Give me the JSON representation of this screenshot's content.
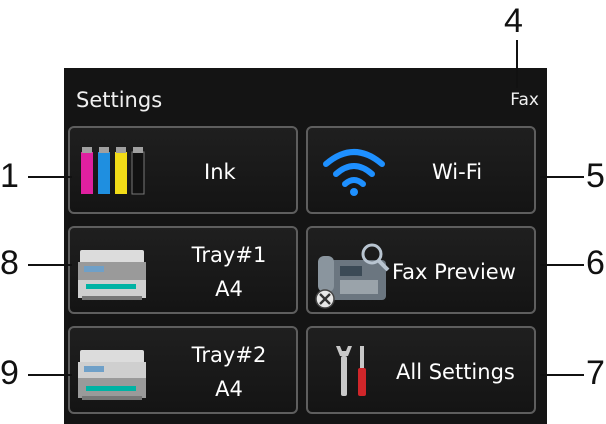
{
  "header": {
    "title": "Settings",
    "right_label": "Fax"
  },
  "tiles": {
    "ink": {
      "label": "Ink",
      "icon": "ink-cartridges-icon"
    },
    "wifi": {
      "label": "Wi-Fi",
      "icon": "wifi-icon"
    },
    "tray1": {
      "line1": "Tray#1",
      "line2": "A4",
      "icon": "printer-icon"
    },
    "fax_preview": {
      "label": "Fax Preview",
      "icon": "fax-machine-icon",
      "badge_icon": "disabled-x-icon"
    },
    "tray2": {
      "line1": "Tray#2",
      "line2": "A4",
      "icon": "printer-icon"
    },
    "all_settings": {
      "label": "All Settings",
      "icon": "tools-icon"
    }
  },
  "callouts": {
    "c1": "1",
    "c4": "4",
    "c5": "5",
    "c6": "6",
    "c7": "7",
    "c8": "8",
    "c9": "9"
  },
  "colors": {
    "screen_bg": "#141414",
    "tile_border": "#5e5e5e",
    "wifi": "#1e90ff",
    "ink_magenta": "#e020a0",
    "ink_cyan": "#1f8fe0",
    "ink_yellow": "#f2dc18",
    "ink_black": "#111111"
  }
}
